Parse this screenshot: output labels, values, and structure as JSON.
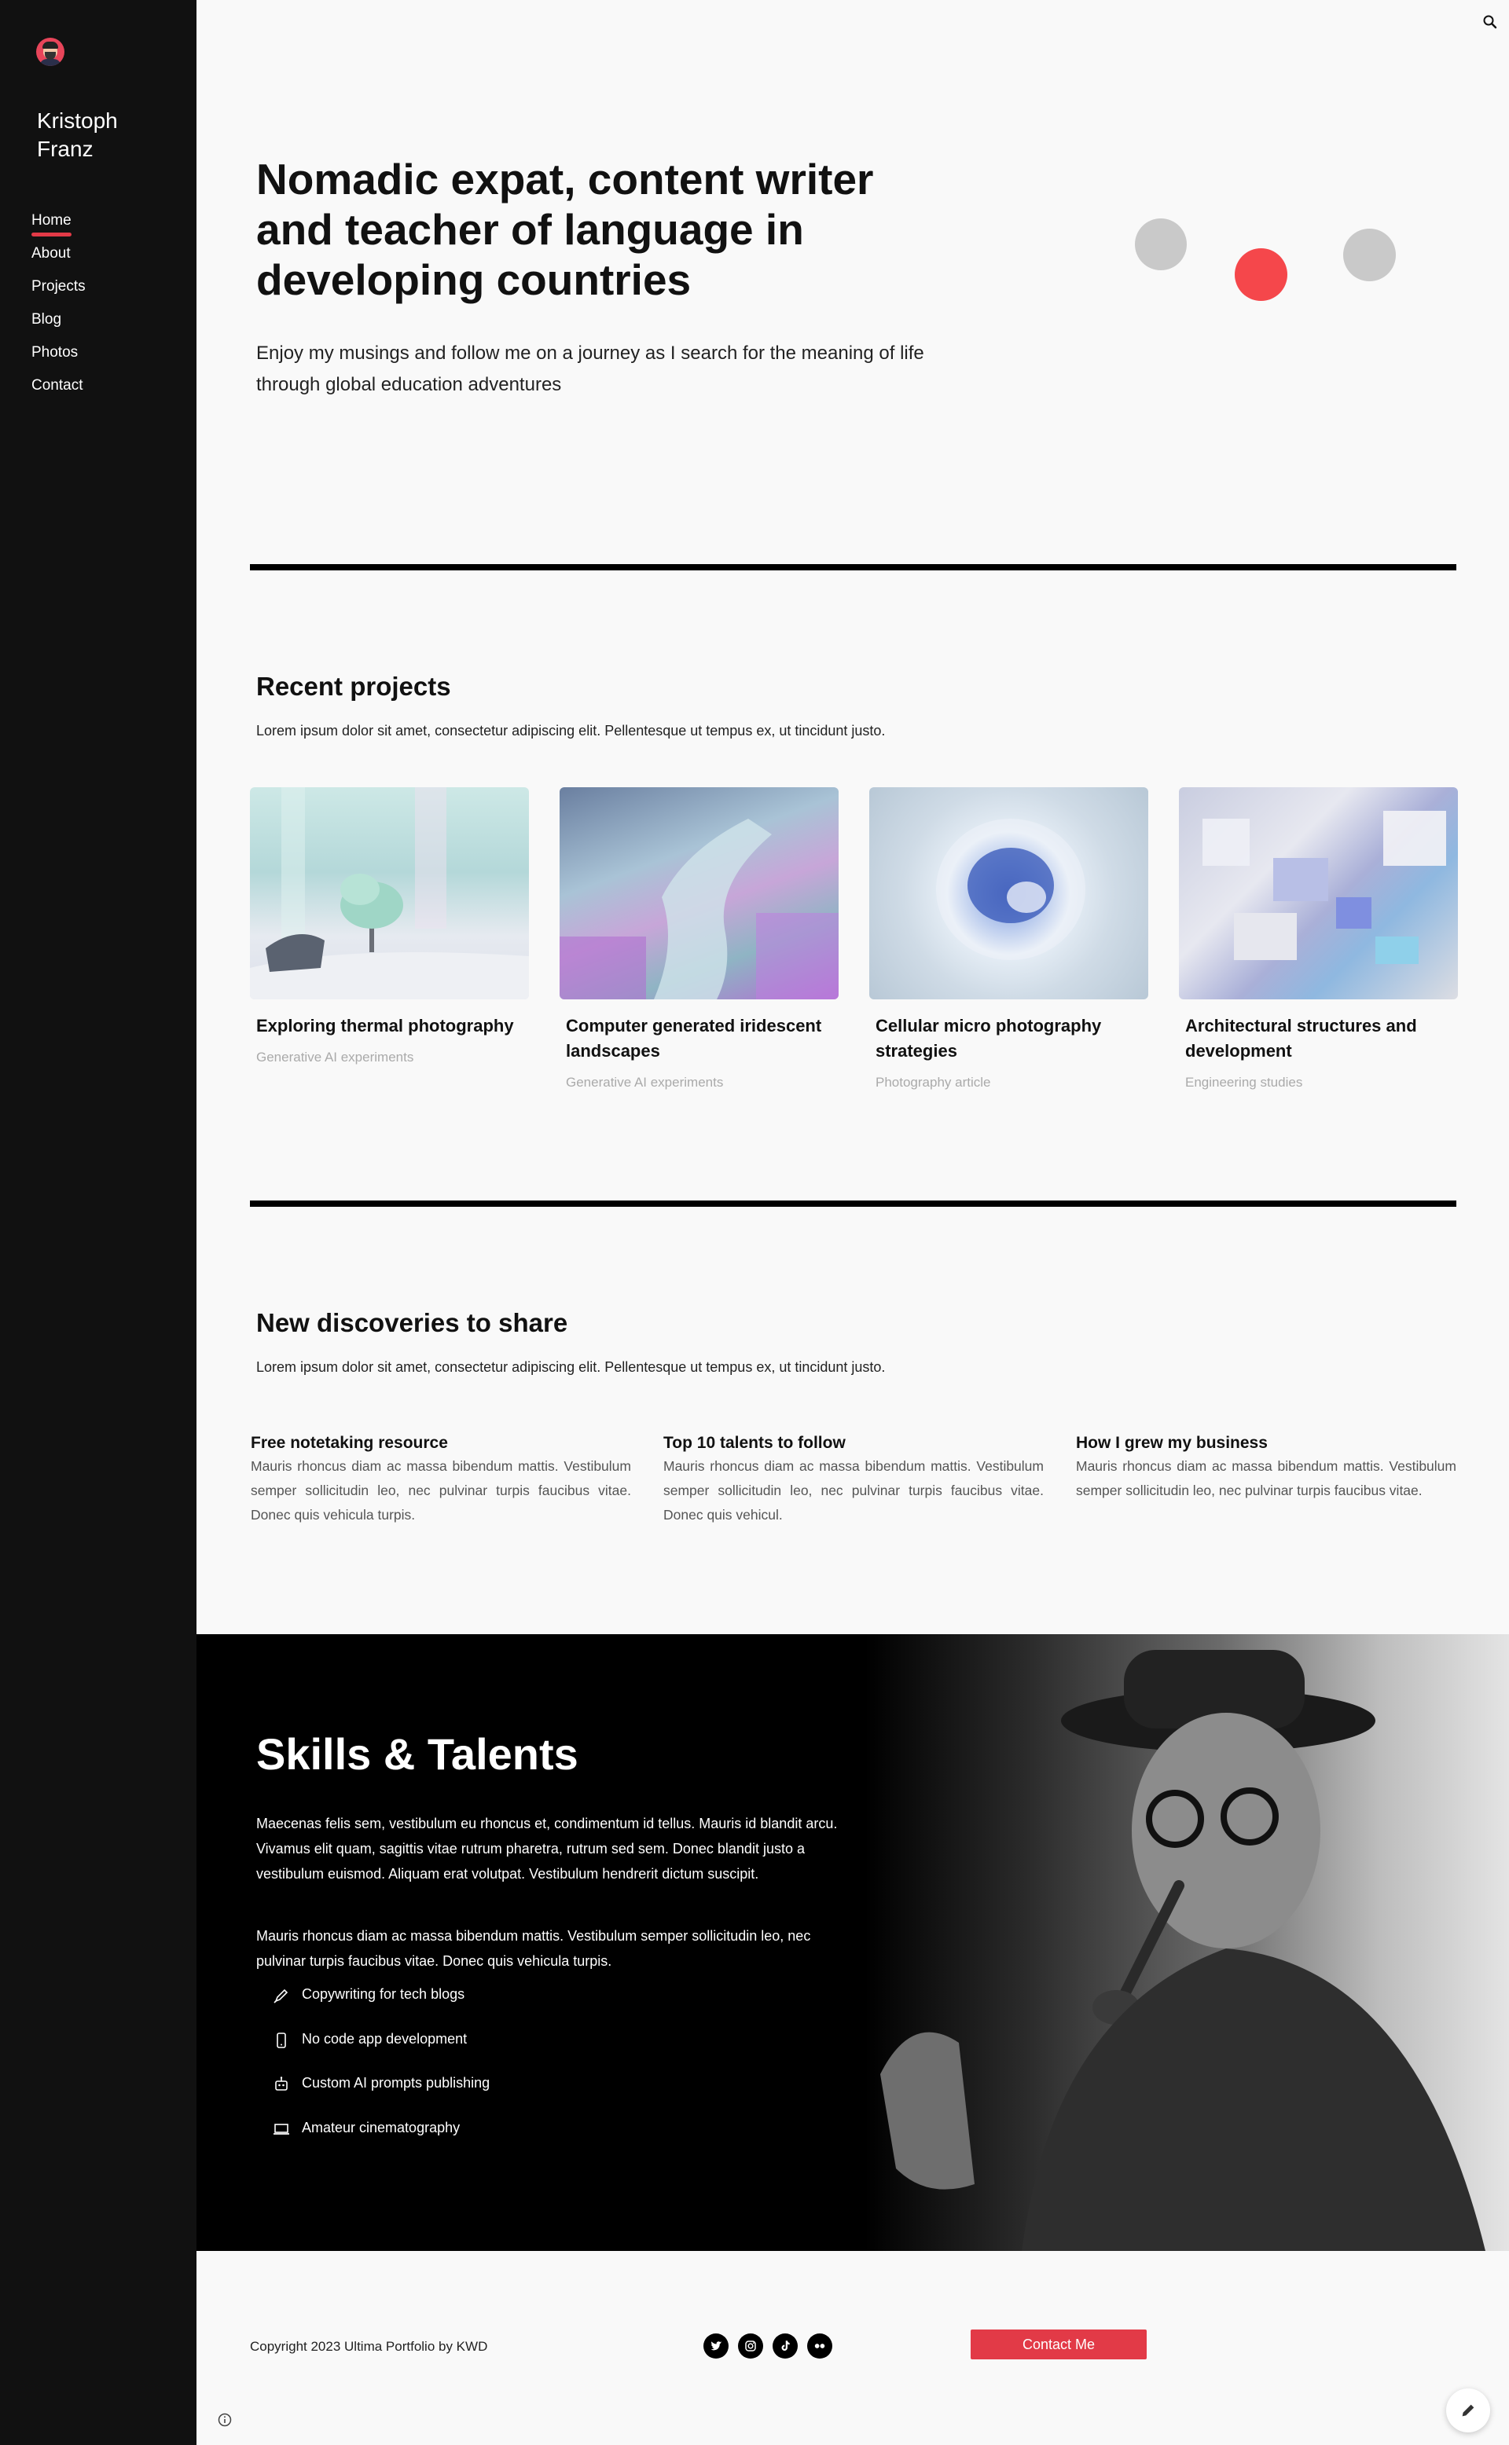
{
  "sidebar": {
    "site_name": "Kristoph Franz",
    "nav": [
      {
        "label": "Home"
      },
      {
        "label": "About"
      },
      {
        "label": "Projects"
      },
      {
        "label": "Blog"
      },
      {
        "label": "Photos"
      },
      {
        "label": "Contact"
      }
    ]
  },
  "hero": {
    "title": "Nomadic expat, content writer and teacher of language in developing countries",
    "subtitle": "Enjoy my musings and follow me on a journey as I search for the meaning of life through global education adventures"
  },
  "projects": {
    "title": "Recent projects",
    "description": "Lorem ipsum dolor sit amet, consectetur adipiscing elit. Pellentesque ut tempus ex, ut tincidunt justo.",
    "items": [
      {
        "title": "Exploring thermal photography",
        "category": "Generative AI experiments"
      },
      {
        "title": "Computer generated iridescent landscapes",
        "category": "Generative AI experiments"
      },
      {
        "title": "Cellular micro photography strategies",
        "category": "Photography article"
      },
      {
        "title": "Architectural structures and development",
        "category": "Engineering studies"
      }
    ]
  },
  "discoveries": {
    "title": "New discoveries to share",
    "description": "Lorem ipsum dolor sit amet, consectetur adipiscing elit. Pellentesque ut tempus ex, ut tincidunt justo.",
    "items": [
      {
        "title": "Free notetaking resource",
        "body": "Mauris rhoncus diam ac massa bibendum mattis. Vestibulum semper sollicitudin leo, nec pulvinar turpis faucibus vitae. Donec quis vehicula turpis."
      },
      {
        "title": "Top 10 talents to follow",
        "body": "Mauris rhoncus diam ac massa bibendum mattis. Vestibulum semper sollicitudin leo, nec pulvinar turpis faucibus vitae. Donec quis vehicul."
      },
      {
        "title": "How I grew my business",
        "body": "Mauris rhoncus diam ac massa bibendum mattis. Vestibulum semper sollicitudin leo, nec pulvinar turpis faucibus vitae."
      }
    ]
  },
  "skills": {
    "title": "Skills & Talents",
    "paragraph1": "Maecenas felis sem, vestibulum eu rhoncus et, condimentum id tellus. Mauris id blandit arcu. Vivamus elit quam, sagittis vitae rutrum pharetra, rutrum sed sem. Donec blandit justo a vestibulum euismod. Aliquam erat volutpat. Vestibulum hendrerit dictum suscipit.",
    "paragraph2": "Mauris rhoncus diam ac massa bibendum mattis. Vestibulum semper sollicitudin leo, nec pulvinar turpis faucibus vitae. Donec quis vehicula turpis.",
    "list": [
      {
        "icon": "pen-icon",
        "label": "Copywriting for tech blogs"
      },
      {
        "icon": "phone-icon",
        "label": "No code app development"
      },
      {
        "icon": "robot-icon",
        "label": "Custom AI prompts publishing"
      },
      {
        "icon": "laptop-icon",
        "label": "Amateur cinematography"
      }
    ]
  },
  "footer": {
    "copyright": "Copyright 2023 Ultima Portfolio by KWD",
    "socials": [
      {
        "icon": "twitter-icon"
      },
      {
        "icon": "instagram-icon"
      },
      {
        "icon": "tiktok-icon"
      },
      {
        "icon": "flickr-icon"
      }
    ],
    "contact_label": "Contact Me"
  },
  "colors": {
    "accent": "#e23a47",
    "sidebar_bg": "#111111",
    "page_bg": "#f9f9f9",
    "dot_red": "#f5474b",
    "dot_gray": "#c9c9c9"
  }
}
